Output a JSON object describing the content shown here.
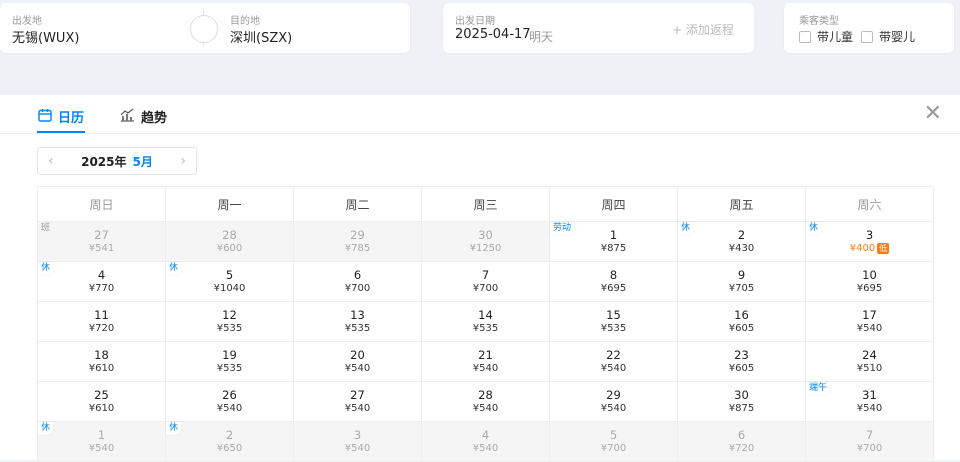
{
  "search": {
    "departure": {
      "label": "出发地",
      "value": "无锡(WUX)"
    },
    "arrival": {
      "label": "目的地",
      "value": "深圳(SZX)"
    },
    "swap_glyph": "⇄",
    "date": {
      "label": "出发日期",
      "value": "2025-04-17",
      "weekday": "明天",
      "add_return": "+ 添加返程"
    },
    "passenger": {
      "label": "乘客类型",
      "child": "带儿童",
      "infant": "带婴儿"
    }
  },
  "tabs": [
    {
      "label": "日历",
      "icon": "calendar-icon",
      "active": true
    },
    {
      "label": "趋势",
      "icon": "trend-chart-icon",
      "active": false
    }
  ],
  "close_glyph": "✕",
  "month_nav": {
    "prev": "‹",
    "year": "2025年",
    "month": "5月",
    "next": "›"
  },
  "weekdays": [
    "周日",
    "周一",
    "周二",
    "周三",
    "周四",
    "周五",
    "周六"
  ],
  "weeks": [
    [
      {
        "day": "27",
        "price": "¥541",
        "dim": true,
        "tag": "班"
      },
      {
        "day": "28",
        "price": "¥600",
        "dim": true
      },
      {
        "day": "29",
        "price": "¥785",
        "dim": true
      },
      {
        "day": "30",
        "price": "¥1250",
        "dim": true
      },
      {
        "day": "1",
        "price": "¥875",
        "tag": "劳动"
      },
      {
        "day": "2",
        "price": "¥430",
        "tag": "休"
      },
      {
        "day": "3",
        "price": "¥400",
        "tag": "休",
        "low": true,
        "low_label": "低"
      }
    ],
    [
      {
        "day": "4",
        "price": "¥770",
        "tag": "休"
      },
      {
        "day": "5",
        "price": "¥1040",
        "tag": "休"
      },
      {
        "day": "6",
        "price": "¥700"
      },
      {
        "day": "7",
        "price": "¥700"
      },
      {
        "day": "8",
        "price": "¥695"
      },
      {
        "day": "9",
        "price": "¥705"
      },
      {
        "day": "10",
        "price": "¥695"
      }
    ],
    [
      {
        "day": "11",
        "price": "¥720"
      },
      {
        "day": "12",
        "price": "¥535"
      },
      {
        "day": "13",
        "price": "¥535"
      },
      {
        "day": "14",
        "price": "¥535"
      },
      {
        "day": "15",
        "price": "¥535"
      },
      {
        "day": "16",
        "price": "¥605"
      },
      {
        "day": "17",
        "price": "¥540"
      }
    ],
    [
      {
        "day": "18",
        "price": "¥610"
      },
      {
        "day": "19",
        "price": "¥535"
      },
      {
        "day": "20",
        "price": "¥540"
      },
      {
        "day": "21",
        "price": "¥540"
      },
      {
        "day": "22",
        "price": "¥540"
      },
      {
        "day": "23",
        "price": "¥605"
      },
      {
        "day": "24",
        "price": "¥510"
      }
    ],
    [
      {
        "day": "25",
        "price": "¥610"
      },
      {
        "day": "26",
        "price": "¥540"
      },
      {
        "day": "27",
        "price": "¥540"
      },
      {
        "day": "28",
        "price": "¥540"
      },
      {
        "day": "29",
        "price": "¥540"
      },
      {
        "day": "30",
        "price": "¥875"
      },
      {
        "day": "31",
        "price": "¥540",
        "tag": "端午"
      }
    ],
    [
      {
        "day": "1",
        "price": "¥540",
        "dim": true,
        "tag": "休"
      },
      {
        "day": "2",
        "price": "¥650",
        "dim": true,
        "tag": "休"
      },
      {
        "day": "3",
        "price": "¥540",
        "dim": true
      },
      {
        "day": "4",
        "price": "¥540",
        "dim": true
      },
      {
        "day": "5",
        "price": "¥700",
        "dim": true
      },
      {
        "day": "6",
        "price": "¥720",
        "dim": true
      },
      {
        "day": "7",
        "price": "¥700",
        "dim": true
      }
    ]
  ],
  "colors": {
    "accent": "#0086f6",
    "low_price": "#ff7d13"
  }
}
